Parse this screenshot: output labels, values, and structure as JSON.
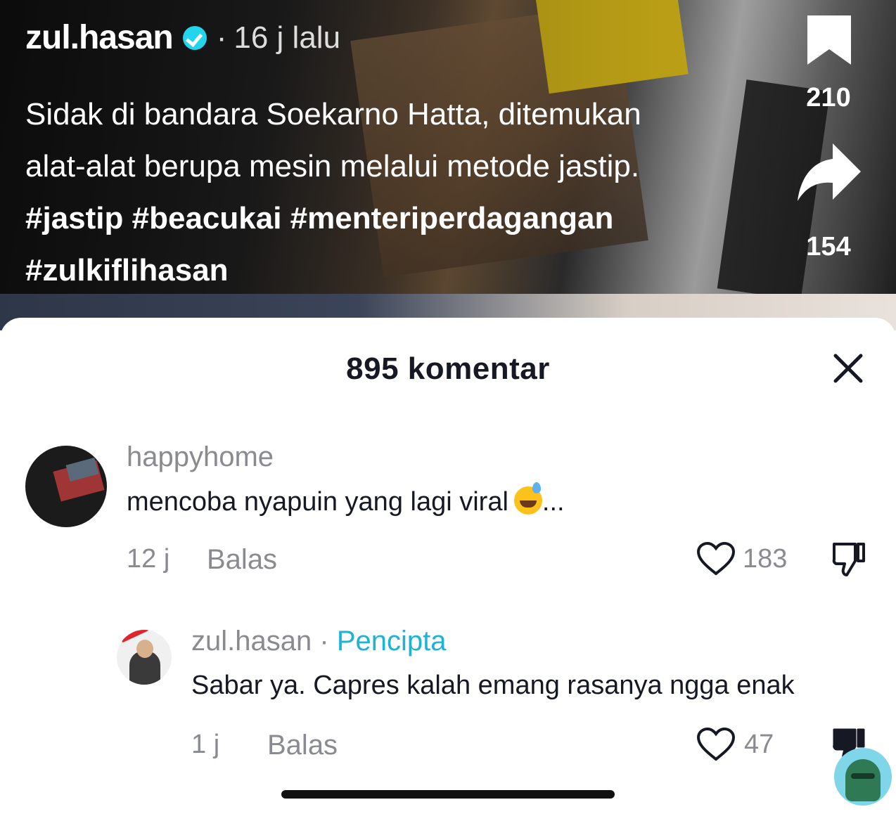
{
  "video": {
    "author": "zul.hasan",
    "separator": "·",
    "time_ago": "16 j lalu",
    "caption_text": "Sidak di bandara Soekarno Hatta, ditemukan alat-alat berupa mesin melalui metode jastip.",
    "hashtags": [
      "#jastip",
      "#beacukai",
      "#menteriperdagangan",
      "#zulkiflihasan"
    ],
    "bookmark_count": "210",
    "share_count": "154"
  },
  "comments_sheet": {
    "title": "895 komentar",
    "comments": [
      {
        "username": "happyhome",
        "text": "mencoba nyapuin yang lagi viral",
        "text_suffix": "...",
        "emoji": "grinning-sweat-emoji",
        "time": "12 j",
        "reply_label": "Balas",
        "likes": "183"
      },
      {
        "username": "zul.hasan",
        "separator": "·",
        "creator_label": "Pencipta",
        "text": "Sabar ya. Capres kalah emang rasanya ngga enak",
        "time": "1 j",
        "reply_label": "Balas",
        "likes": "47"
      }
    ]
  },
  "colors": {
    "creator_accent": "#20b2d6",
    "verified": "#20d5ec",
    "text_primary": "#161823",
    "text_secondary": "#8a8b91"
  }
}
